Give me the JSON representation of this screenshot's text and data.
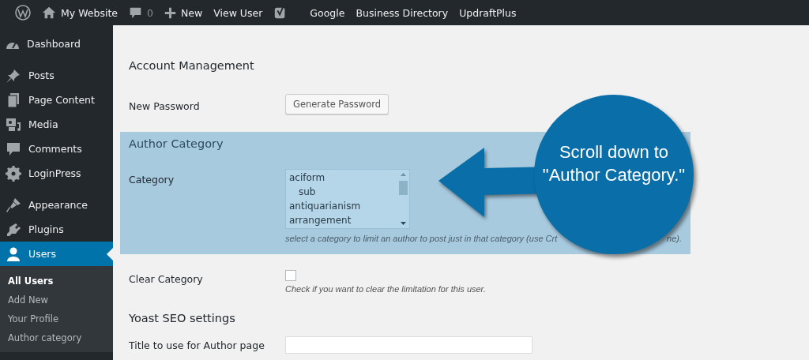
{
  "admin_bar": {
    "items": [
      {
        "kind": "logo"
      },
      {
        "kind": "home",
        "label": "My Website"
      },
      {
        "kind": "comments",
        "label": "0"
      },
      {
        "kind": "new",
        "label": "New"
      },
      {
        "kind": "text",
        "label": "View User"
      },
      {
        "kind": "yoast"
      },
      {
        "kind": "text",
        "label": "Google"
      },
      {
        "kind": "text",
        "label": "Business Directory"
      },
      {
        "kind": "text",
        "label": "UpdraftPlus"
      }
    ]
  },
  "sidebar": {
    "items": [
      {
        "label": "Dashboard",
        "selected": false
      },
      {
        "label": "Posts",
        "selected": false
      },
      {
        "label": "Page Content",
        "selected": false
      },
      {
        "label": "Media",
        "selected": false
      },
      {
        "label": "Comments",
        "selected": false
      },
      {
        "label": "LoginPress",
        "selected": false
      },
      {
        "label": "Appearance",
        "selected": false
      },
      {
        "label": "Plugins",
        "selected": false
      },
      {
        "label": "Users",
        "selected": true,
        "children": [
          {
            "label": "All Users",
            "selected": true
          },
          {
            "label": "Add New",
            "selected": false
          },
          {
            "label": "Your Profile",
            "selected": false
          },
          {
            "label": "Author category",
            "selected": false
          }
        ]
      }
    ]
  },
  "form": {
    "sections": [
      {
        "kind": "heading",
        "text": "Account Management",
        "highlighted": false
      },
      {
        "kind": "button_row",
        "label": "New Password",
        "button": "Generate Password"
      },
      {
        "kind": "heading",
        "text": "Author Category",
        "highlighted": true
      },
      {
        "kind": "listbox_row",
        "label": "Category",
        "highlighted": true,
        "options": [
          {
            "label": "aciform",
            "children": [
              {
                "label": "sub"
              }
            ]
          },
          {
            "label": "antiquarianism"
          },
          {
            "label": "arrangement"
          }
        ],
        "description": "select a category to limit an author to post just in that category (use Crt",
        "description_tail": "ne)."
      },
      {
        "kind": "checkbox_row",
        "label": "Clear Category",
        "checked": false,
        "description": "Check if you want to clear the limitation for this user."
      },
      {
        "kind": "heading",
        "text": "Yoast SEO settings",
        "highlighted": false
      },
      {
        "kind": "text_row",
        "label": "Title to use for Author page"
      }
    ]
  },
  "callout": {
    "text": "Scroll down to\n\"Author Category.\""
  }
}
